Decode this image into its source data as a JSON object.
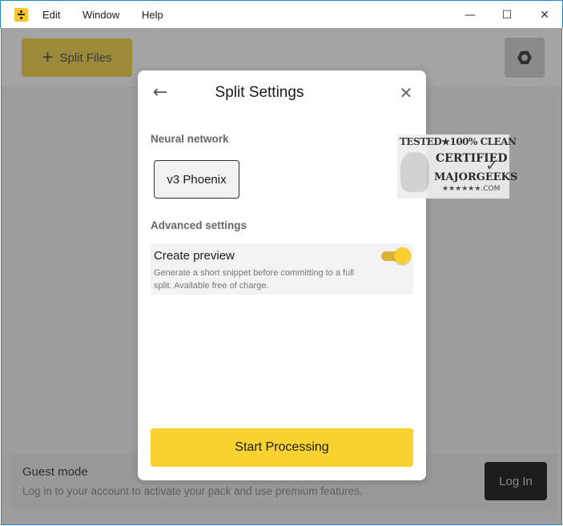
{
  "menu": {
    "items": [
      "Edit",
      "Window",
      "Help"
    ]
  },
  "window_controls": {
    "minimize": "—",
    "maximize": "☐",
    "close": "✕"
  },
  "toolbar": {
    "split_files_label": "Split Files",
    "split_files_icon": "+",
    "settings_icon": "gear-icon"
  },
  "guest": {
    "title": "Guest mode",
    "subtitle": "Log in to your account to activate your pack and use premium features.",
    "login_label": "Log In"
  },
  "modal": {
    "title": "Split Settings",
    "back_icon": "←",
    "close_icon": "✕",
    "neural_network_label": "Neural network",
    "neural_network_value": "v3 Phoenix",
    "advanced_label": "Advanced settings",
    "preview": {
      "title": "Create preview",
      "description": "Generate a short snippet before committing to a full split. Available free of charge.",
      "enabled": true
    },
    "start_label": "Start Processing"
  },
  "watermark": {
    "line1": "TESTED★100% CLEAN",
    "line2": "CERTIFIED",
    "line3": "MAJORGEEKS",
    "line4": "★★★★★★.COM"
  },
  "colors": {
    "accent_yellow": "#f9d230",
    "overlay_gray": "#9e9e9e",
    "window_border": "#1e88c8"
  }
}
